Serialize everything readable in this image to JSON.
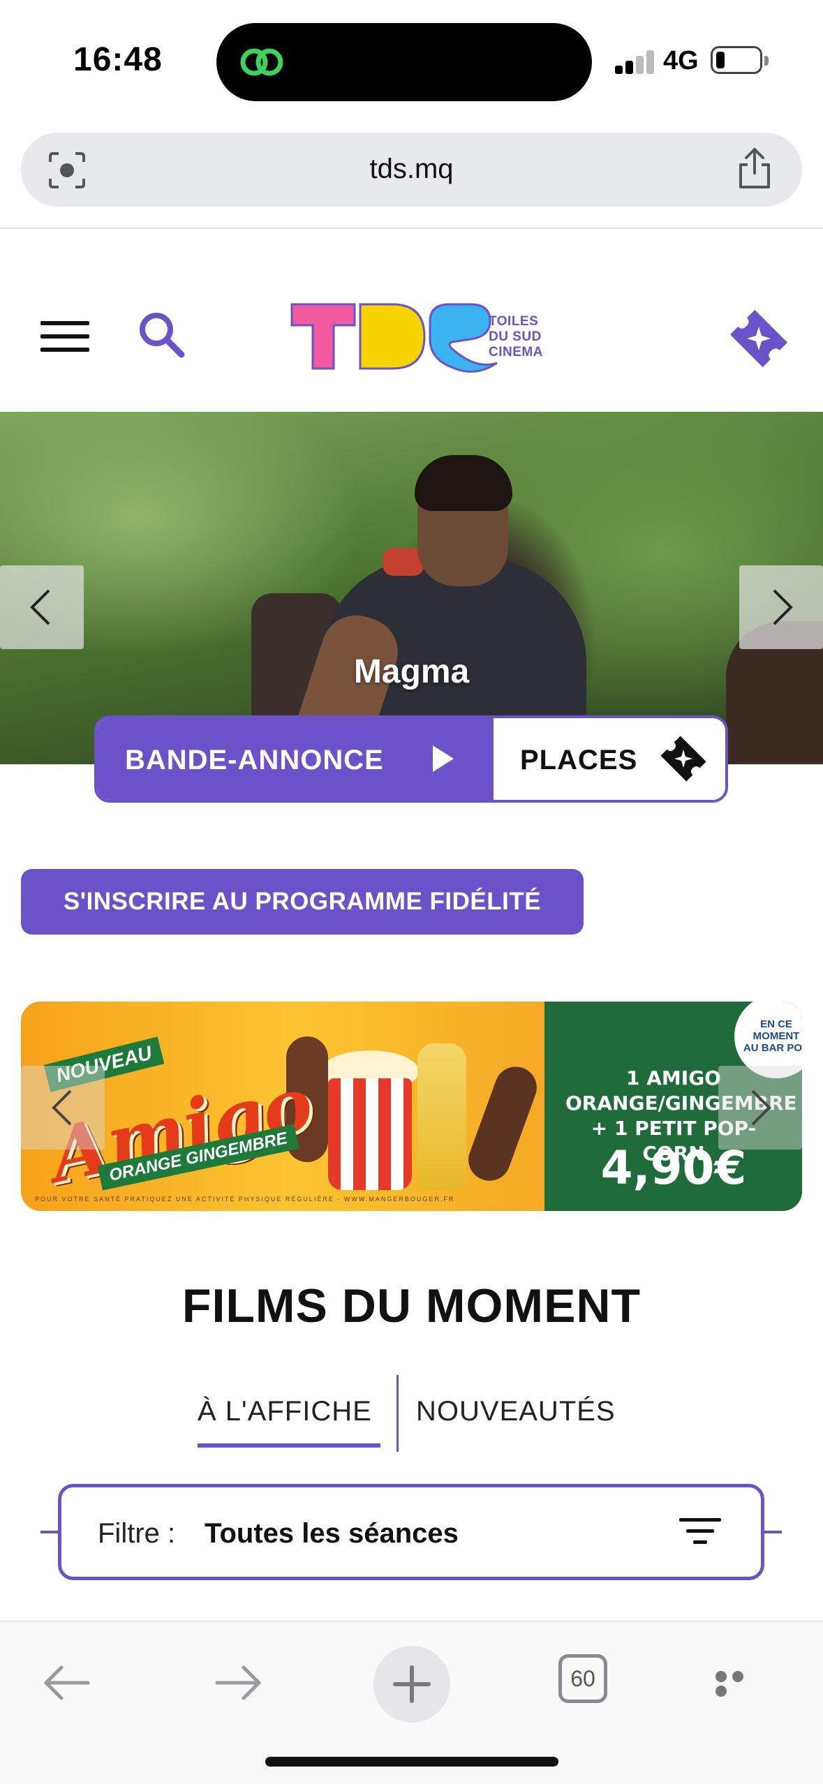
{
  "status_bar": {
    "time": "16:48",
    "network": "4G"
  },
  "browser": {
    "url": "tds.mq",
    "open_tabs": "60"
  },
  "header": {
    "logo_letters": "TDS",
    "logo_tagline": [
      "TOILES",
      "DU SUD",
      "CINEMA"
    ]
  },
  "hero": {
    "movie_title": "Magma",
    "trailer_label": "BANDE-ANNONCE",
    "tickets_label": "PLACES"
  },
  "loyalty": {
    "label": "S'INSCRIRE AU PROGRAMME FIDÉLITÉ"
  },
  "ad": {
    "badge": "NOUVEAU",
    "brand": "Amigo",
    "flavor": "ORANGE GINGEMBRE",
    "offer_lines": [
      "1 AMIGO",
      "ORANGE/GINGEMBRE",
      "+ 1 PETIT POP-CORN"
    ],
    "price": "4,90€",
    "corner_badge": [
      "EN CE",
      "MOMENT",
      "AU BAR POP"
    ],
    "disclaimer": "POUR VOTRE SANTÉ PRATIQUEZ UNE ACTIVITÉ PHYSIQUE RÉGULIÈRE · WWW.MANGERBOUGER.FR"
  },
  "films": {
    "title": "FILMS DU MOMENT",
    "tabs": [
      {
        "label": "À L'AFFICHE",
        "active": true
      },
      {
        "label": "NOUVEAUTÉS",
        "active": false
      }
    ],
    "filter_label": "Filtre :",
    "filter_value": "Toutes les séances"
  },
  "colors": {
    "accent": "#6b52c9",
    "ad_green": "#1f6b3a"
  },
  "icons": [
    "island-app-icon",
    "signal-icon",
    "battery-icon",
    "lens-icon",
    "share-icon",
    "menu-icon",
    "search-icon",
    "ticket-icon",
    "chevron-left-icon",
    "chevron-right-icon",
    "play-icon",
    "filter-icon",
    "back-icon",
    "forward-icon",
    "plus-icon",
    "more-icon"
  ]
}
